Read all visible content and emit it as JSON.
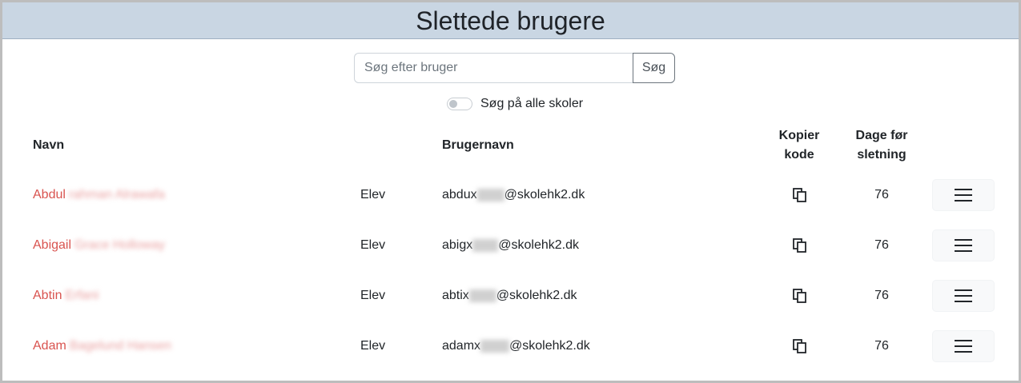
{
  "header": {
    "title": "Slettede brugere"
  },
  "search": {
    "placeholder": "Søg efter bruger",
    "button_label": "Søg"
  },
  "toggle": {
    "label": "Søg på alle skoler",
    "checked": false
  },
  "table": {
    "columns": {
      "name": "Navn",
      "username": "Brugernavn",
      "copy_line1": "Kopier",
      "copy_line2": "kode",
      "days_line1": "Dage før",
      "days_line2": "sletning"
    },
    "rows": [
      {
        "first": "Abdul",
        "rest_blurred": "rahman Alrawafa",
        "role": "Elev",
        "user_prefix": "abdux",
        "user_suffix": "@skolehk2.dk",
        "days": "76"
      },
      {
        "first": "Abigail",
        "rest_blurred": "Grace Holloway",
        "role": "Elev",
        "user_prefix": "abigx",
        "user_suffix": "@skolehk2.dk",
        "days": "76"
      },
      {
        "first": "Abtin",
        "rest_blurred": "Erfani",
        "role": "Elev",
        "user_prefix": "abtix",
        "user_suffix": "@skolehk2.dk",
        "days": "76"
      },
      {
        "first": "Adam",
        "rest_blurred": "Bagelund Hansen",
        "role": "Elev",
        "user_prefix": "adamx",
        "user_suffix": "@skolehk2.dk",
        "days": "76"
      }
    ]
  }
}
